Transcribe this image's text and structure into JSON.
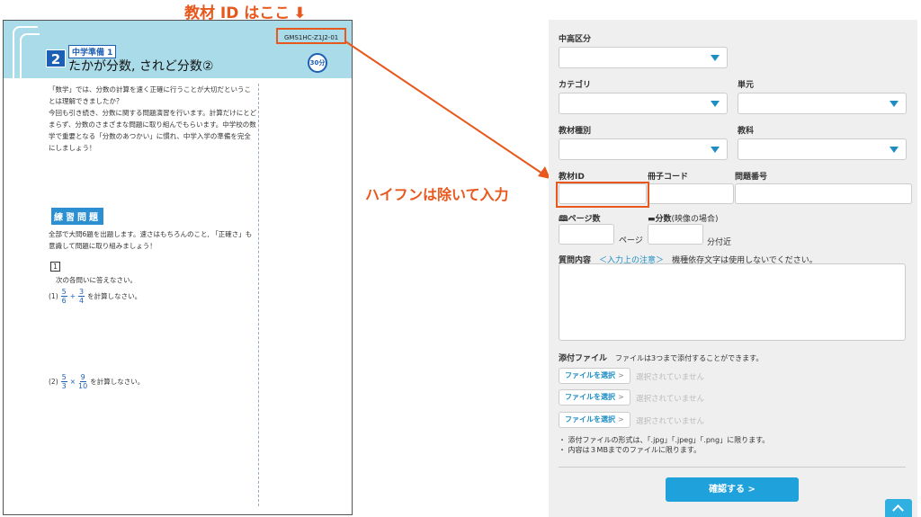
{
  "annotations": {
    "material_id_here": "教材 ID はここ",
    "down_arrow": "⬇",
    "remove_hyphen": "ハイフンは除いて入力"
  },
  "worksheet": {
    "number": "2",
    "sub_tag": "中学準備 1",
    "title": "たかが分数, されど分数②",
    "material_id": "GMS1HC-Z1J2-01",
    "minutes": "30分",
    "intro": [
      "「数学」では、分数の計算を速く正確に行うことが大切だということは理解できましたか？",
      "今回も引き続き、分数に関する問題演習を行います。計算だけにとどまらず、分数のさまざまな問題に取り組んでもらいます。中学校の数学で重要となる「分数のあつかい」に慣れ、中学入学の準備を完全にしましょう！"
    ],
    "practice_label": "練習問題",
    "practice_intro": "全部で大問6題を出題します。速さはもちろんのこと, 「正確さ」も意識して問題に取り組みましょう！",
    "q_number": "1",
    "q_prompt": "次の各問いに答えなさい。",
    "q1": {
      "label": "(1)",
      "a_num": "5",
      "a_den": "6",
      "op": "+",
      "b_num": "3",
      "b_den": "4",
      "suffix": "を計算しなさい。"
    },
    "q2": {
      "label": "(2)",
      "a_num": "5",
      "a_den": "3",
      "op": "×",
      "b_num": "9",
      "b_den": "10",
      "suffix": "を計算しなさい。"
    }
  },
  "form": {
    "school_level": {
      "label": "中高区分",
      "value": ""
    },
    "category": {
      "label": "カテゴリ",
      "value": ""
    },
    "unit": {
      "label": "単元",
      "value": ""
    },
    "material_type": {
      "label": "教材種別",
      "value": ""
    },
    "subject": {
      "label": "教科",
      "value": ""
    },
    "material_id": {
      "label": "教材ID",
      "value": ""
    },
    "booklet_code": {
      "label": "冊子コード",
      "value": ""
    },
    "question_number": {
      "label": "問題番号",
      "value": ""
    },
    "page_count": {
      "label": "ページ数",
      "unit": "ページ"
    },
    "minutes": {
      "label": "分数",
      "label_note": "(映像の場合)",
      "unit": "分付近"
    },
    "question_content": {
      "label": "質問内容",
      "link": "＜入力上の注意＞",
      "note": "機種依存文字は使用しないでください。",
      "value": ""
    },
    "attachments": {
      "label": "添付ファイル",
      "note": "ファイルは3つまで添付することができます。",
      "button_label": "ファイルを選択",
      "button_chevron": ">",
      "status": "選択されていません",
      "rules": [
        "・ 添付ファイルの形式は、「.jpg」「.jpeg」「.png」に限ります。",
        "・ 内容は３MBまでのファイルに限ります。"
      ]
    },
    "confirm_label": "確認する >"
  },
  "colors": {
    "accent": "#1fa1dc",
    "annotation": "#e8581c",
    "sheet_header": "#a9dbe8"
  }
}
